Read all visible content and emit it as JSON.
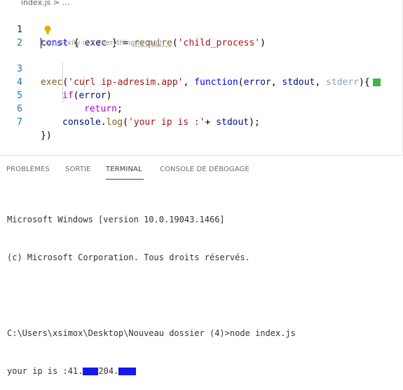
{
  "breadcrumb": {
    "file": "index.js",
    "separator": ">",
    "ellipsis": "..."
  },
  "editor": {
    "lines": [
      {
        "number": "1",
        "tokens": [
          "const",
          " { ",
          "exec",
          " } = ",
          "require",
          "(",
          "'child_process'",
          ")"
        ]
      },
      {
        "number": "2"
      },
      {
        "number": "3",
        "tokens": [
          "exec",
          "(",
          "'curl ip-adresim.app'",
          ", ",
          "function",
          "(",
          "error",
          ", ",
          "stdout",
          ", ",
          "stderr",
          "){"
        ]
      },
      {
        "number": "4",
        "tokens": [
          "if",
          "(",
          "error",
          ")"
        ]
      },
      {
        "number": "5",
        "tokens": [
          "return",
          ";"
        ]
      },
      {
        "number": "6",
        "tokens": [
          "console",
          ".",
          "log",
          "(",
          "'your ip is :'",
          "+ ",
          "stdout",
          ");"
        ]
      },
      {
        "number": "7",
        "tokens": [
          "})"
        ]
      }
    ],
    "codelens": "Complexity is 3 Everything is cool!",
    "complexity_status_color": "#3fb44a"
  },
  "panel": {
    "tabs": [
      "PROBLÈMES",
      "SORTIE",
      "TERMINAL",
      "CONSOLE DE DÉBOGAGE"
    ],
    "active_tab": "TERMINAL"
  },
  "terminal": {
    "header1": "Microsoft Windows [version 10.0.19043.1466]",
    "header2": "(c) Microsoft Corporation. Tous droits réservés.",
    "prompt": "C:\\Users\\xsimox\\Desktop\\Nouveau dossier (4)>",
    "command": "node index.js",
    "output_prefix": "your ip is :41.",
    "output_mid": "204.",
    "redaction_color": "#1616f0"
  }
}
